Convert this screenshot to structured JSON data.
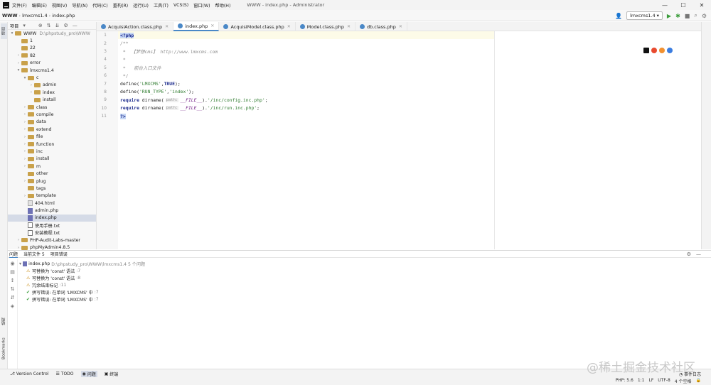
{
  "menu": [
    "文件(F)",
    "编辑(E)",
    "视图(V)",
    "导航(N)",
    "代码(C)",
    "重构(R)",
    "运行(U)",
    "工具(T)",
    "VCS(S)",
    "窗口(W)",
    "帮助(H)"
  ],
  "window_title": "WWW - index.php - Administrator",
  "window_controls": {
    "minimize": "—",
    "maximize": "☐",
    "close": "✕"
  },
  "breadcrumb": {
    "root": "WWW",
    "folder": "lmxcms1.4",
    "file": "index.php"
  },
  "run_config": "lmxcms1.4",
  "project_panel": {
    "label": "项目"
  },
  "tree": [
    {
      "indent": 0,
      "arrow": "▾",
      "type": "folder",
      "name": "WWW",
      "path": "D:\\phpstudy_pro\\WWW"
    },
    {
      "indent": 1,
      "arrow": "",
      "type": "folder",
      "name": "1"
    },
    {
      "indent": 1,
      "arrow": "",
      "type": "folder",
      "name": "22"
    },
    {
      "indent": 1,
      "arrow": "›",
      "type": "folder",
      "name": "82"
    },
    {
      "indent": 1,
      "arrow": "›",
      "type": "folder",
      "name": "error"
    },
    {
      "indent": 1,
      "arrow": "▾",
      "type": "folder",
      "name": "lmxcms1.4"
    },
    {
      "indent": 2,
      "arrow": "▾",
      "type": "folder",
      "name": "c"
    },
    {
      "indent": 3,
      "arrow": "›",
      "type": "folder",
      "name": "admin"
    },
    {
      "indent": 3,
      "arrow": "›",
      "type": "folder",
      "name": "index"
    },
    {
      "indent": 3,
      "arrow": "",
      "type": "folder",
      "name": "install"
    },
    {
      "indent": 2,
      "arrow": "›",
      "type": "folder",
      "name": "class"
    },
    {
      "indent": 2,
      "arrow": "›",
      "type": "folder",
      "name": "compile"
    },
    {
      "indent": 2,
      "arrow": "›",
      "type": "folder",
      "name": "data"
    },
    {
      "indent": 2,
      "arrow": "›",
      "type": "folder",
      "name": "extend"
    },
    {
      "indent": 2,
      "arrow": "›",
      "type": "folder",
      "name": "file"
    },
    {
      "indent": 2,
      "arrow": "›",
      "type": "folder",
      "name": "function"
    },
    {
      "indent": 2,
      "arrow": "›",
      "type": "folder",
      "name": "inc"
    },
    {
      "indent": 2,
      "arrow": "›",
      "type": "folder",
      "name": "install"
    },
    {
      "indent": 2,
      "arrow": "›",
      "type": "folder",
      "name": "m"
    },
    {
      "indent": 2,
      "arrow": "",
      "type": "folder",
      "name": "other"
    },
    {
      "indent": 2,
      "arrow": "›",
      "type": "folder",
      "name": "plug"
    },
    {
      "indent": 2,
      "arrow": "",
      "type": "folder",
      "name": "tags"
    },
    {
      "indent": 2,
      "arrow": "›",
      "type": "folder",
      "name": "template"
    },
    {
      "indent": 2,
      "arrow": "",
      "type": "file",
      "name": "404.html"
    },
    {
      "indent": 2,
      "arrow": "",
      "type": "php",
      "name": "admin.php"
    },
    {
      "indent": 2,
      "arrow": "",
      "type": "php",
      "name": "index.php",
      "selected": true
    },
    {
      "indent": 2,
      "arrow": "",
      "type": "txt",
      "name": "使用手册.txt"
    },
    {
      "indent": 2,
      "arrow": "",
      "type": "txt",
      "name": "安装教程.txt"
    },
    {
      "indent": 1,
      "arrow": "›",
      "type": "folder",
      "name": "PHP-Audit-Labs-master"
    },
    {
      "indent": 1,
      "arrow": "›",
      "type": "folder",
      "name": "phpMyAdmin4.8.5"
    }
  ],
  "tabs": [
    {
      "name": "AcquisiAction.class.php",
      "active": false
    },
    {
      "name": "index.php",
      "active": true
    },
    {
      "name": "AcquisiModel.class.php",
      "active": false
    },
    {
      "name": "Model.class.php",
      "active": false
    },
    {
      "name": "db.class.php",
      "active": false
    }
  ],
  "code_lines": [
    {
      "n": "1",
      "html": "<span class='sel-bg kw'>&lt;?php</span>",
      "cur": true
    },
    {
      "n": "2",
      "html": "<span class='cm'>/**</span>"
    },
    {
      "n": "3",
      "html": "<span class='cm'> *  【梦想cms】 http://www.lmxcms.com</span>"
    },
    {
      "n": "4",
      "html": "<span class='cm'> *</span>"
    },
    {
      "n": "5",
      "html": "<span class='cm'> *   前台入口文件</span>"
    },
    {
      "n": "6",
      "html": "<span class='cm'> */</span>"
    },
    {
      "n": "7",
      "html": "<span class='func'>define(</span><span class='str'>'LMXCMS'</span><span class='func'>,</span><span class='kw'>TRUE</span><span class='func'>);</span>"
    },
    {
      "n": "8",
      "html": "<span class='func'>define(</span><span class='str'>'RUN_TYPE'</span><span class='func'>,</span><span class='str'>'index'</span><span class='func'>);</span>"
    },
    {
      "n": "9",
      "html": "<span class='kw'>require </span><span class='func'>dirname(</span><span class='hint'>path:</span><span class='const'>__FILE__</span><span class='func'>).</span><span class='str'>'/inc/config.inc.php'</span><span class='func'>;</span>"
    },
    {
      "n": "10",
      "html": "<span class='kw'>require </span><span class='func'>dirname(</span><span class='hint'>path:</span><span class='const'>__FILE__</span><span class='func'>).</span><span class='str'>'/inc/run.inc.php'</span><span class='func'>;</span>"
    },
    {
      "n": "11",
      "html": "<span class='sel-bg kw'>?&gt;</span>"
    }
  ],
  "problems": {
    "tabs": [
      "问题",
      "当前文件 5",
      "项目错误"
    ],
    "file": "index.php",
    "file_path": "D:\\phpstudy_pro\\WWW\\lmxcms1.4  5 个问题",
    "items": [
      {
        "kind": "warn",
        "text": "可替换为 'const' 语法",
        "loc": ":7"
      },
      {
        "kind": "warn",
        "text": "可替换为 'const' 语法",
        "loc": ":8"
      },
      {
        "kind": "warn",
        "text": "冗余结束标记",
        "loc": ":11"
      },
      {
        "kind": "spell",
        "text": "拼写错误: 在单词 'LMXCMS' 中",
        "loc": ":7"
      },
      {
        "kind": "spell",
        "text": "拼写错误: 在单词 'LMXCMS' 中",
        "loc": ":7"
      }
    ]
  },
  "bottom_tabs": [
    "Version Control",
    "TODO",
    "问题",
    "终端"
  ],
  "status_right": [
    "PHP: 5.6",
    "1:1",
    "LF",
    "UTF-8",
    "4 个空格"
  ],
  "event_log": "事件日志",
  "side_labels": {
    "structure": "结构",
    "bookmarks": "Bookmarks"
  },
  "watermark": "@稀土掘金技术社区"
}
